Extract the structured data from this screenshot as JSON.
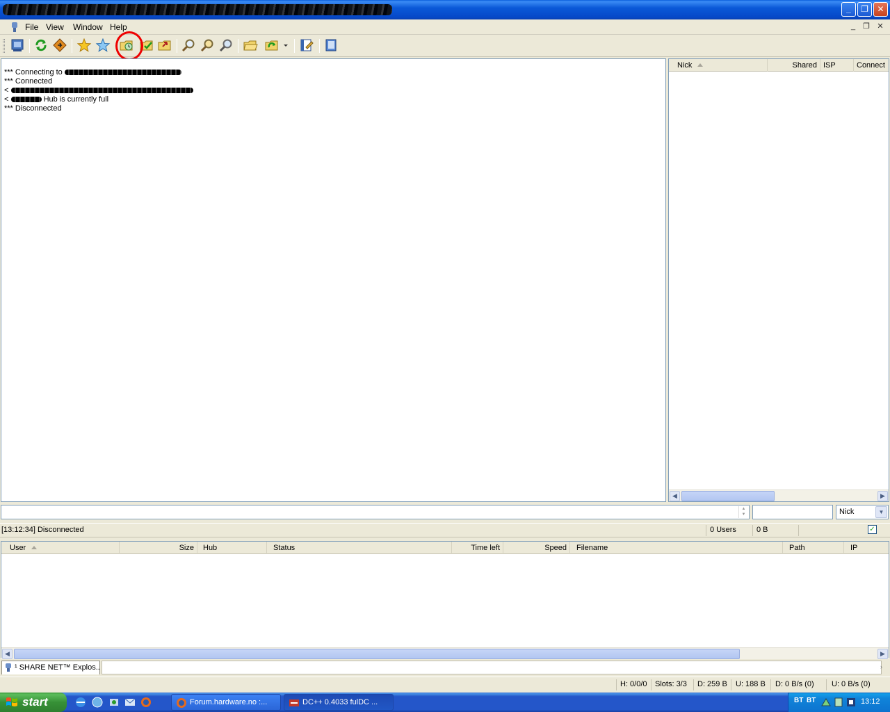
{
  "titlebar": {
    "minimize": "_",
    "maximize": "❐",
    "close": "✕"
  },
  "menu": {
    "items": [
      "File",
      "View",
      "Window",
      "Help"
    ],
    "mdi": [
      "_",
      "❐",
      "✕"
    ]
  },
  "toolbar": {
    "buttons": [
      "public-hubs",
      "reconnect",
      "follow-redirect",
      "favorite-hubs",
      "favorite-users",
      "recent-hubs",
      "download-queue",
      "finished-downloads",
      "search",
      "adl-search",
      "search-spy",
      "open-file-list",
      "refresh-file-list",
      "settings",
      "notepad"
    ]
  },
  "chat": {
    "lines": [
      {
        "prefix": "***",
        "text": "Connecting to"
      },
      {
        "prefix": "***",
        "text": "Connected"
      },
      {
        "prefix": "<",
        "text": ""
      },
      {
        "prefix": "<",
        "text": "Hub is currently full"
      },
      {
        "prefix": "***",
        "text": "Disconnected"
      }
    ]
  },
  "userlist": {
    "columns": [
      "Nick",
      "Shared",
      "ISP",
      "Connect"
    ]
  },
  "search_type": {
    "selected": "Nick"
  },
  "hubstatus": {
    "message": "[13:12:34] Disconnected",
    "users": "0 Users",
    "shared": "0 B",
    "check": "✓"
  },
  "transfers": {
    "columns": [
      "User",
      "Size",
      "Hub",
      "Status",
      "Time left",
      "Speed",
      "Filename",
      "Path",
      "IP"
    ]
  },
  "tabs": [
    {
      "label": "¹ SHARE NET™ Explos..."
    }
  ],
  "status": {
    "hubs": "H: 0/0/0",
    "slots": "Slots: 3/3",
    "downloaded": "D: 259 B",
    "uploaded": "U: 188 B",
    "down_speed": "D: 0 B/s (0)",
    "up_speed": "U: 0 B/s (0)"
  },
  "taskbar": {
    "start": "start",
    "buttons": [
      "Forum.hardware.no :...",
      "DC++ 0.4033 fulDC ..."
    ],
    "tray": [
      "BT",
      "BT"
    ],
    "clock": "13:12"
  },
  "colors": {
    "accent": "#0a5fdc",
    "highlight_circle": "#e00000",
    "taskbar": "#2456c9",
    "start": "#379137"
  }
}
